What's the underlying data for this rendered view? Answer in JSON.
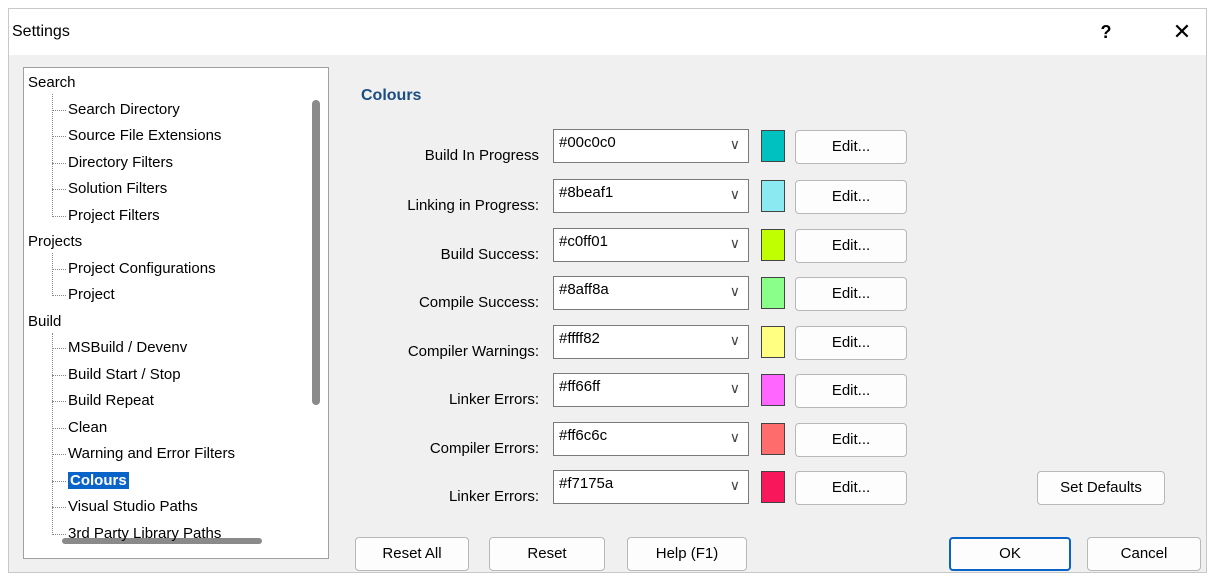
{
  "window": {
    "title": "Settings",
    "help_glyph": "?",
    "close_glyph": "✕"
  },
  "tree": {
    "items": [
      {
        "label": "Search",
        "level": 0
      },
      {
        "label": "Search Directory",
        "level": 1
      },
      {
        "label": "Source File Extensions",
        "level": 1
      },
      {
        "label": "Directory Filters",
        "level": 1
      },
      {
        "label": "Solution Filters",
        "level": 1
      },
      {
        "label": "Project Filters",
        "level": 1
      },
      {
        "label": "Projects",
        "level": 0
      },
      {
        "label": "Project Configurations",
        "level": 1
      },
      {
        "label": "Project",
        "level": 1
      },
      {
        "label": "Build",
        "level": 0
      },
      {
        "label": "MSBuild / Devenv",
        "level": 1
      },
      {
        "label": "Build Start / Stop",
        "level": 1
      },
      {
        "label": "Build Repeat",
        "level": 1
      },
      {
        "label": "Clean",
        "level": 1
      },
      {
        "label": "Warning and Error Filters",
        "level": 1
      },
      {
        "label": "Colours",
        "level": 1,
        "selected": true
      },
      {
        "label": "Visual Studio Paths",
        "level": 1
      },
      {
        "label": "3rd Party Library Paths",
        "level": 1
      }
    ]
  },
  "panel": {
    "title": "Colours",
    "rows": [
      {
        "label": "Build In Progress",
        "value": "#00c0c0",
        "color": "#00c0c0",
        "edit": "Edit..."
      },
      {
        "label": "Linking in Progress:",
        "value": "#8beaf1",
        "color": "#8beaf1",
        "edit": "Edit..."
      },
      {
        "label": "Build Success:",
        "value": "#c0ff01",
        "color": "#c0ff01",
        "edit": "Edit..."
      },
      {
        "label": "Compile Success:",
        "value": "#8aff8a",
        "color": "#8aff8a",
        "edit": "Edit..."
      },
      {
        "label": "Compiler Warnings:",
        "value": "#ffff82",
        "color": "#ffff82",
        "edit": "Edit..."
      },
      {
        "label": "Linker Errors:",
        "value": "#ff66ff",
        "color": "#ff66ff",
        "edit": "Edit..."
      },
      {
        "label": "Compiler Errors:",
        "value": "#ff6c6c",
        "color": "#ff6c6c",
        "edit": "Edit..."
      },
      {
        "label": "Linker Errors:",
        "value": "#f7175a",
        "color": "#f7175a",
        "edit": "Edit..."
      }
    ],
    "set_defaults": "Set Defaults"
  },
  "footer": {
    "reset_all": "Reset All",
    "reset": "Reset",
    "help": "Help (F1)",
    "ok": "OK",
    "cancel": "Cancel"
  },
  "colors": {
    "accent": "#0a64c8",
    "section_title": "#1a4d80"
  }
}
